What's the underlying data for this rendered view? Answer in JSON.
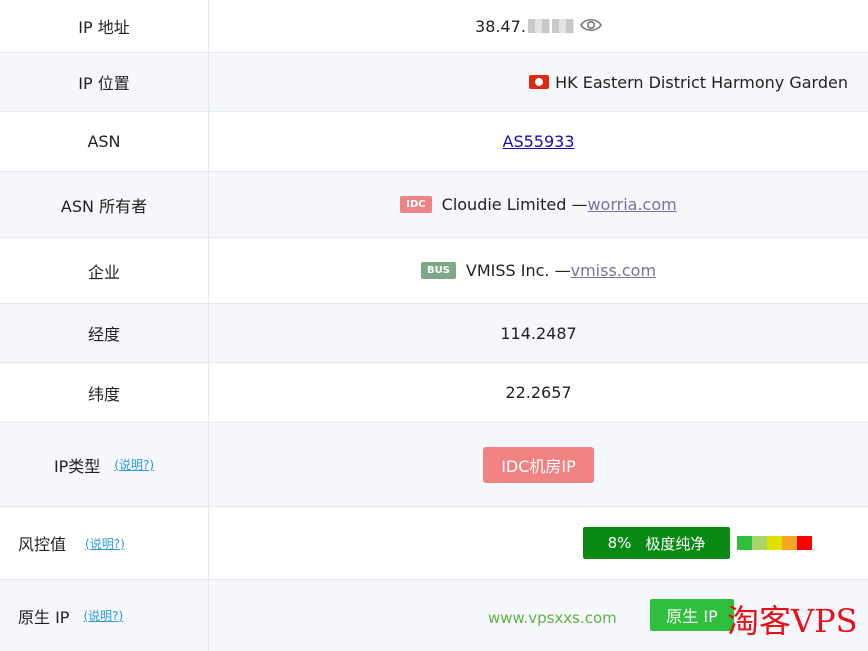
{
  "rows": {
    "ip_address": {
      "label": "IP 地址",
      "value_prefix": "38.47.",
      "eye_icon": "eye-icon"
    },
    "ip_location": {
      "label": "IP 位置",
      "flag_icon": "hk-flag-icon",
      "value": "HK Eastern District Harmony Garden"
    },
    "asn": {
      "label": "ASN",
      "value": "AS55933"
    },
    "asn_owner": {
      "label": "ASN 所有者",
      "badge": "IDC",
      "name": "Cloudie Limited —",
      "link": "worria.com"
    },
    "company": {
      "label": "企业",
      "badge": "BUS",
      "name": "VMISS Inc. —",
      "link": "vmiss.com"
    },
    "longitude": {
      "label": "经度",
      "value": "114.2487"
    },
    "latitude": {
      "label": "纬度",
      "value": "22.2657"
    },
    "ip_type": {
      "label": "IP类型",
      "explain": "(说明?)",
      "value": "IDC机房IP"
    },
    "risk": {
      "label": "风控值",
      "explain": "(说明?)",
      "score": "8%",
      "level": "极度纯净",
      "scale_colors": [
        "#2fbf3d",
        "#a9d36b",
        "#e0e000",
        "#f5a623",
        "#ff0000"
      ]
    },
    "native_ip": {
      "label": "原生 IP",
      "explain": "(说明?)",
      "value": "原生 IP"
    }
  },
  "watermark": {
    "url": "www.vpsxxs.com",
    "brand": "淘客VPS"
  },
  "colors": {
    "row_alt_bg": "#f6f7fa",
    "border": "#e6e8ef",
    "idc_badge": "#ef8282",
    "bus_badge": "#7fa886",
    "risk_green": "#0a8a14",
    "native_green": "#2fbf3d"
  }
}
